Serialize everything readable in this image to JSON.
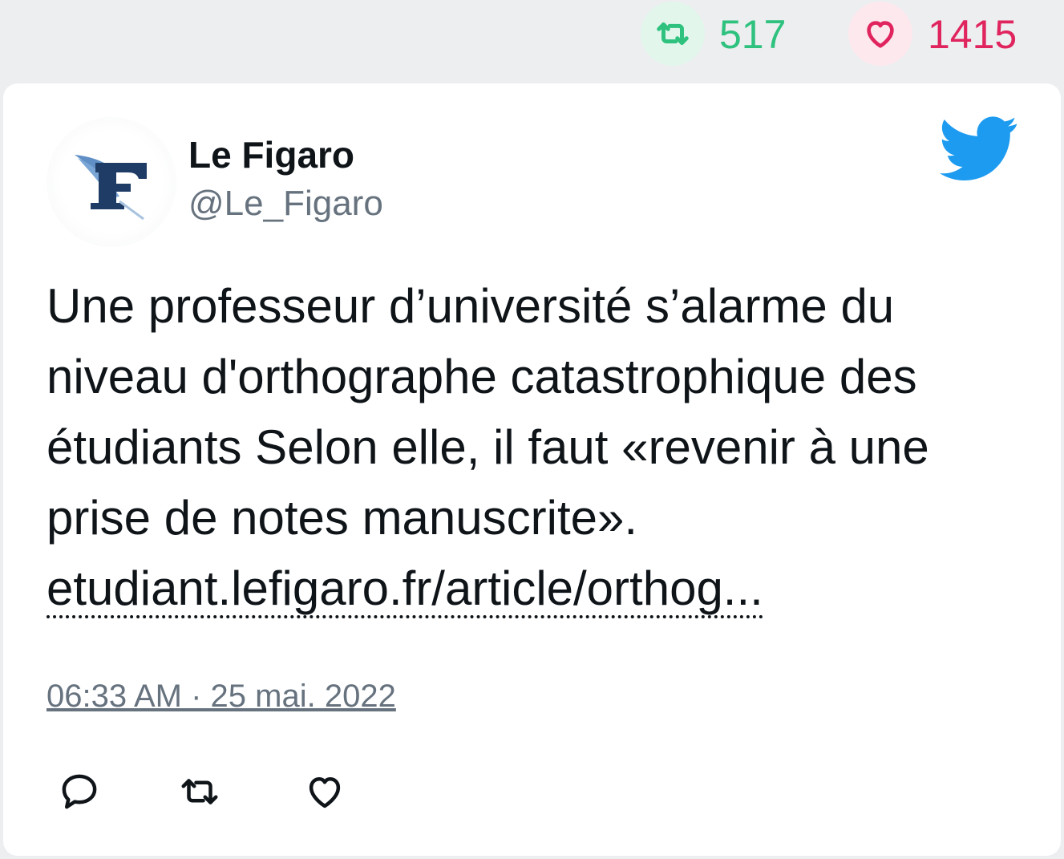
{
  "stats": {
    "retweets": "517",
    "likes": "1415",
    "colors": {
      "retweet": "#2ec27e",
      "like": "#e0245e"
    }
  },
  "tweet": {
    "author_name": "Le Figaro",
    "author_handle": "@Le_Figaro",
    "text": "Une professeur d’université s’alarme du niveau d'orthographe catastrophique des étudiants Selon elle, il faut «revenir à une prise de notes manuscrite».",
    "link": "etudiant.lefigaro.fr/article/orthog...",
    "timestamp": "06:33 AM · 25 mai. 2022"
  },
  "icons": {
    "brand": "twitter-bird-icon",
    "actions": [
      "reply-icon",
      "retweet-icon",
      "like-icon"
    ]
  }
}
